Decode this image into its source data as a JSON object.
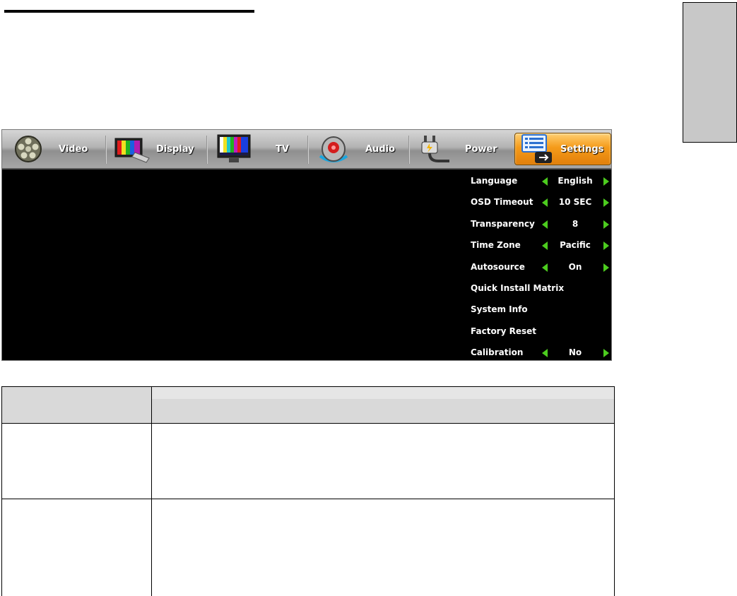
{
  "menu": {
    "tabs": [
      {
        "label": "Video",
        "icon": "film-reel-icon"
      },
      {
        "label": "Display",
        "icon": "color-bars-monitor-icon"
      },
      {
        "label": "TV",
        "icon": "tv-test-pattern-icon"
      },
      {
        "label": "Audio",
        "icon": "speaker-icon"
      },
      {
        "label": "Power",
        "icon": "power-plug-icon"
      },
      {
        "label": "Settings",
        "icon": "settings-list-icon",
        "active": true
      }
    ]
  },
  "settings": {
    "items": [
      {
        "name": "Language",
        "value": "English"
      },
      {
        "name": "OSD Timeout",
        "value": "10 SEC"
      },
      {
        "name": "Transparency",
        "value": "8"
      },
      {
        "name": "Time Zone",
        "value": "Pacific"
      },
      {
        "name": "Autosource",
        "value": "On"
      },
      {
        "name": "Quick Install Matrix",
        "value": ""
      },
      {
        "name": "System Info",
        "value": ""
      },
      {
        "name": "Factory Reset",
        "value": ""
      },
      {
        "name": "Calibration",
        "value": "No"
      }
    ]
  },
  "colors": {
    "accent": "#f59b1a",
    "arrow": "#4ccc1e",
    "screen": "#000000",
    "table_header": "#d9d9d9",
    "side_tab": "#c8c8c8"
  }
}
